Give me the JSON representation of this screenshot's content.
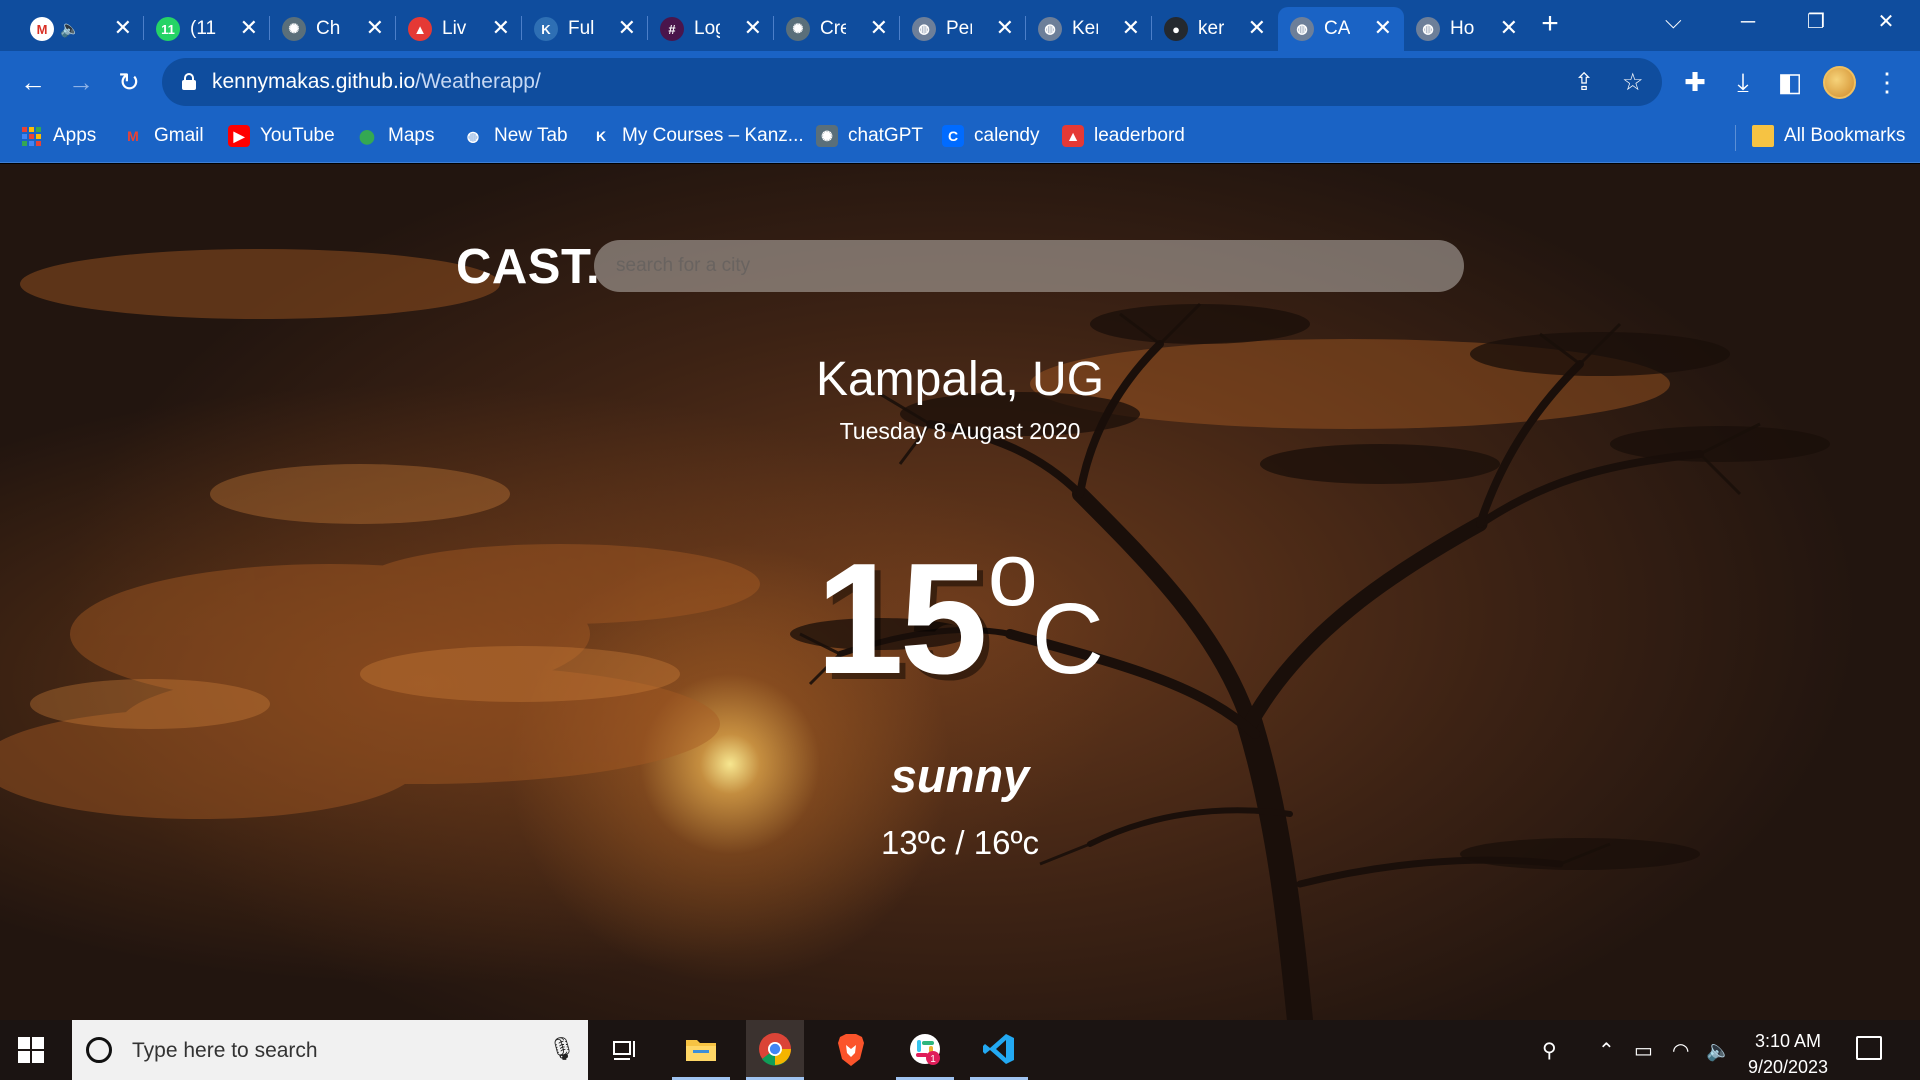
{
  "browser": {
    "tabs": [
      {
        "title": "",
        "fav_color": "#ffffff",
        "fav_text": "M",
        "fav_text_color": "#d93025",
        "audio": true
      },
      {
        "title": "(11",
        "fav_color": "#25d366",
        "fav_text": "11"
      },
      {
        "title": "Ch",
        "fav_color": "#5a6f7a",
        "fav_text": "✺"
      },
      {
        "title": "Liv",
        "fav_color": "#e53935",
        "fav_text": "▲"
      },
      {
        "title": "Ful",
        "fav_color": "#2e6fb4",
        "fav_text": "K"
      },
      {
        "title": "Log",
        "fav_color": "#4a154b",
        "fav_text": "#"
      },
      {
        "title": "Cre",
        "fav_color": "#5a6f7a",
        "fav_text": "✺"
      },
      {
        "title": "Per",
        "fav_color": "#6d7f99",
        "fav_text": "◍"
      },
      {
        "title": "Ker",
        "fav_color": "#6d7f99",
        "fav_text": "◍"
      },
      {
        "title": "ker",
        "fav_color": "#24292f",
        "fav_text": "●"
      },
      {
        "title": "CA",
        "fav_color": "#6d7f99",
        "fav_text": "◍",
        "active": true
      },
      {
        "title": "Ho",
        "fav_color": "#6d7f99",
        "fav_text": "◍"
      }
    ],
    "close_glyph": "✕",
    "new_tab": "+",
    "url_host": "kennymakas.github.io",
    "url_path": "/Weatherapp/",
    "bookmarks": [
      {
        "label": "Apps",
        "icon": "apps-grid-icon"
      },
      {
        "label": "Gmail",
        "icon": "gmail-icon",
        "fav_text": "M",
        "fav_color": "transparent",
        "fav_text_color": "#ea4335"
      },
      {
        "label": "YouTube",
        "icon": "youtube-icon",
        "fav_text": "▶",
        "fav_color": "#ff0000",
        "fav_text_color": "#ffffff"
      },
      {
        "label": "Maps",
        "icon": "maps-pin-icon",
        "fav_text": "⬤",
        "fav_color": "transparent",
        "fav_text_color": "#34a853"
      },
      {
        "label": "New Tab",
        "icon": "globe-icon",
        "fav_text": "◍",
        "fav_color": "transparent",
        "fav_text_color": "#ffffff"
      },
      {
        "label": "My Courses – Kanz...",
        "icon": "kanzu-icon",
        "fav_text": "K",
        "fav_color": "transparent",
        "fav_text_color": "#ffffff"
      },
      {
        "label": "chatGPT",
        "icon": "chatgpt-icon",
        "fav_text": "✺",
        "fav_color": "#5a6f7a",
        "fav_text_color": "#ffffff"
      },
      {
        "label": "calendy",
        "icon": "calendly-icon",
        "fav_text": "C",
        "fav_color": "#006bff",
        "fav_text_color": "#ffffff"
      },
      {
        "label": "leaderbord",
        "icon": "leaderboard-icon",
        "fav_text": "▲",
        "fav_color": "#e53935",
        "fav_text_color": "#ffffff"
      }
    ],
    "all_bookmarks": "All Bookmarks"
  },
  "app": {
    "brand": "CAST.",
    "search_placeholder": "search for a city",
    "city": "Kampala, UG",
    "date": "Tuesday 8 Augast 2020",
    "temp_value": "15",
    "temp_degree": "o",
    "temp_unit": "C",
    "condition": "sunny",
    "range": "13ºc / 16ºc"
  },
  "taskbar": {
    "search_placeholder": "Type here to search",
    "time": "3:10 AM",
    "date": "9/20/2023",
    "slack_badge": "1"
  },
  "colors": {
    "chrome_dark": "#0f4d9e",
    "chrome": "#1a63c5",
    "taskbar": "#1b1412"
  }
}
